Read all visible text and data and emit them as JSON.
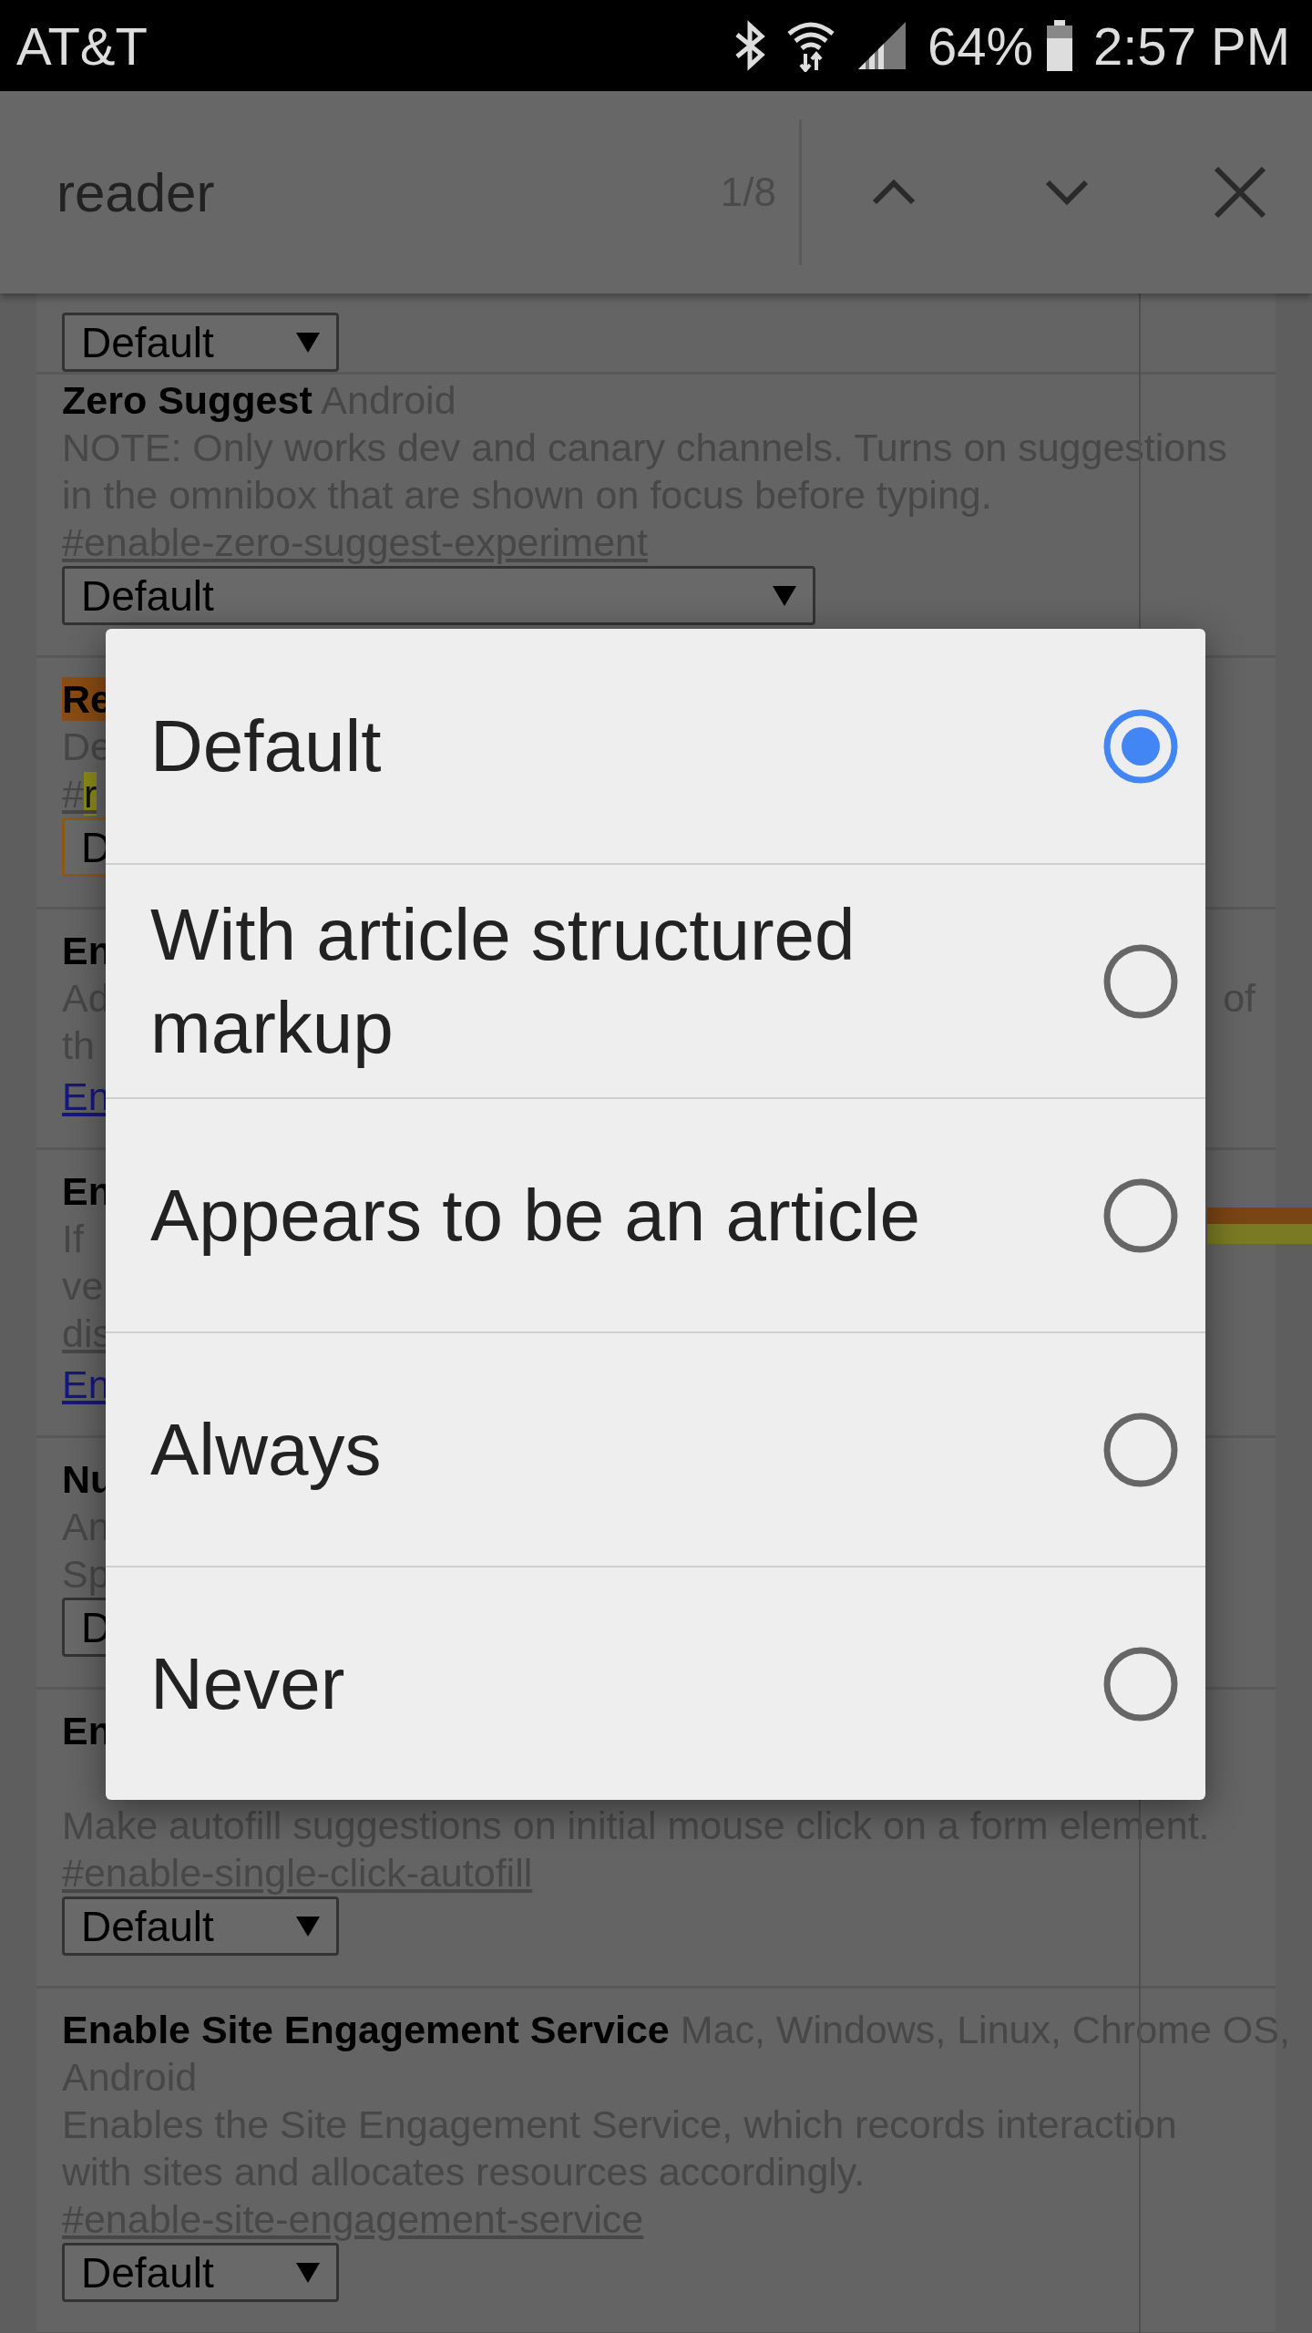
{
  "status_bar": {
    "carrier": "AT&T",
    "battery": "64%",
    "time": "2:57 PM"
  },
  "find_bar": {
    "query": "reader",
    "count": "1/8"
  },
  "flags": [
    {
      "select": "Default",
      "select_caret": true
    },
    {
      "title": "Zero Suggest",
      "platforms": "Android",
      "description": "NOTE: Only works dev and canary channels. Turns on suggestions in the omnibox that are shown on focus before typing.",
      "link": "#enable-zero-suggest-experiment",
      "select": "Default",
      "select_caret": true
    },
    {
      "title": "Re",
      "title_match": true,
      "lines": [
        {
          "kind": "text",
          "text": "De"
        }
      ],
      "link": "#",
      "link_match": "r",
      "select": "D",
      "select_match": true
    },
    {
      "title": "En",
      "lines": [
        {
          "kind": "text",
          "text": "Ad",
          "right": "of"
        },
        {
          "kind": "text",
          "text": "th"
        }
      ],
      "enable_link": "En"
    },
    {
      "title": "En",
      "lines": [
        {
          "kind": "text",
          "text": "If"
        },
        {
          "kind": "text",
          "text": "ve"
        },
        {
          "kind": "link",
          "text": "dis"
        }
      ],
      "enable_link": "En"
    },
    {
      "title": "Nu",
      "lines": [
        {
          "kind": "text",
          "text": "An"
        },
        {
          "kind": "text",
          "text": "Sp"
        }
      ],
      "select": "D"
    },
    {
      "title": "En",
      "description": "Make autofill suggestions on initial mouse click on a form element.",
      "link": "#enable-single-click-autofill",
      "select": "Default",
      "select_caret": true
    },
    {
      "title": "Enable Site Engagement Service",
      "platforms": "Mac, Windows, Linux, Chrome OS,",
      "lines": [
        {
          "kind": "text",
          "text": "Android"
        }
      ],
      "description": "Enables the Site Engagement Service, which records interaction with sites and allocates resources accordingly.",
      "link": "#enable-site-engagement-service",
      "select": "Default",
      "select_caret": true
    }
  ],
  "dialog": {
    "options": [
      {
        "label": "Default",
        "selected": true
      },
      {
        "label": "With article structured markup",
        "selected": false
      },
      {
        "label": "Appears to be an article",
        "selected": false
      },
      {
        "label": "Always",
        "selected": false
      },
      {
        "label": "Never",
        "selected": false
      }
    ]
  }
}
